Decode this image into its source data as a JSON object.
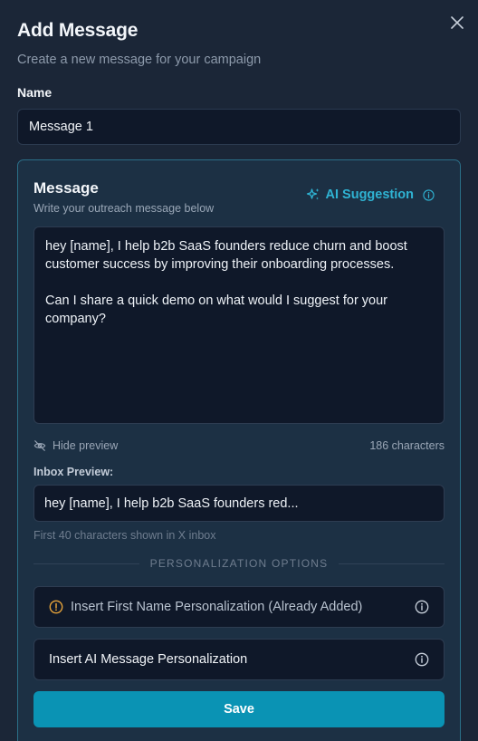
{
  "header": {
    "title": "Add Message",
    "subtitle": "Create a new message for your campaign"
  },
  "name_field": {
    "label": "Name",
    "value": "Message 1"
  },
  "message_card": {
    "title": "Message",
    "subtitle": "Write your outreach message below",
    "ai_suggestion_label": "AI Suggestion",
    "message_text": "hey [name], I help b2b SaaS founders reduce churn and boost customer success by improving their onboarding processes.\n\nCan I share a quick demo on what would I suggest for your company?",
    "hide_preview_label": "Hide preview",
    "character_count": "186 characters",
    "inbox_preview_label": "Inbox Preview:",
    "inbox_preview_text": "hey [name], I help b2b SaaS founders red...",
    "inbox_note": "First 40 characters shown in X inbox",
    "personalization_heading": "PERSONALIZATION OPTIONS",
    "options": [
      {
        "label": "Insert First Name Personalization (Already Added)",
        "icon": "warning-icon"
      },
      {
        "label": "Insert AI Message Personalization",
        "icon": ""
      }
    ],
    "save_label": "Save"
  },
  "colors": {
    "background": "#1b2637",
    "card_background": "#1c3044",
    "card_border": "#2b6f88",
    "accent": "#2fb3d3",
    "save_button": "#0a93b4",
    "warning": "#e5a23a",
    "input_background": "#0f1829"
  }
}
